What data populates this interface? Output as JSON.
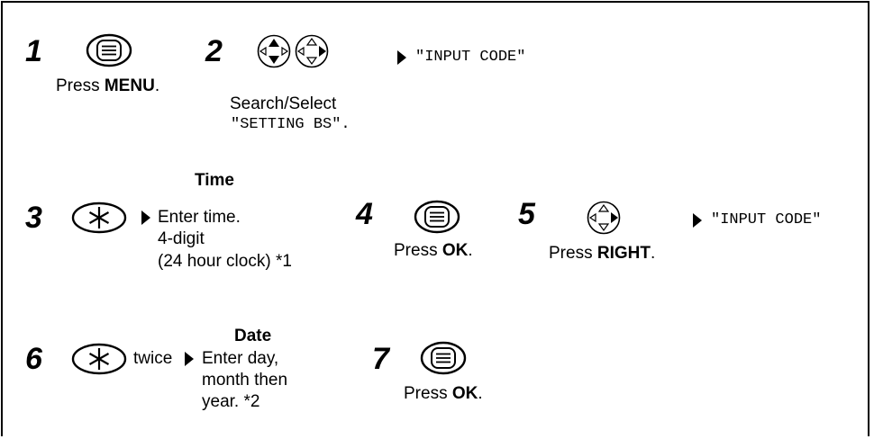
{
  "steps": {
    "s1": {
      "num": "1",
      "pre": "Press ",
      "key": "MENU",
      "post": ".",
      "icon": "menu-button-icon"
    },
    "s2": {
      "num": "2",
      "line1": "Search/Select",
      "line2": "\"SETTING BS\".",
      "result": "\"INPUT CODE\"",
      "icon": "navigation-pad-up-down-icon"
    },
    "s3": {
      "num": "3",
      "heading": "Time",
      "lines": [
        "Enter time.",
        "4-digit",
        "(24 hour clock) *1"
      ],
      "icon": "asterisk-key-icon"
    },
    "s4": {
      "num": "4",
      "pre": "Press ",
      "key": "OK",
      "post": ".",
      "icon": "menu-button-icon"
    },
    "s5": {
      "num": "5",
      "pre": "Press ",
      "key": "RIGHT",
      "post": ".",
      "result": "\"INPUT CODE\"",
      "icon": "navigation-pad-right-icon"
    },
    "s6": {
      "num": "6",
      "extra": "twice",
      "heading": "Date",
      "lines": [
        "Enter day,",
        "month then",
        "year. *2"
      ],
      "icon": "asterisk-key-icon"
    },
    "s7": {
      "num": "7",
      "pre": "Press ",
      "key": "OK",
      "post": ".",
      "icon": "menu-button-icon"
    }
  }
}
